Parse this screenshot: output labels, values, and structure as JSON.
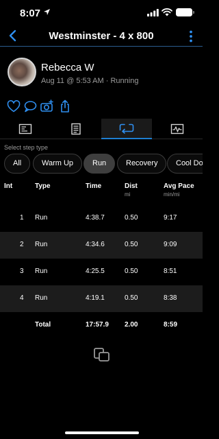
{
  "status_bar": {
    "time": "8:07"
  },
  "nav": {
    "title": "Westminster - 4 x 800"
  },
  "profile": {
    "name": "Rebecca W",
    "meta": "Aug 11 @ 5:53 AM · Running"
  },
  "step_type": {
    "label": "Select step type",
    "chips": [
      "All",
      "Warm Up",
      "Run",
      "Recovery",
      "Cool Down"
    ],
    "selected": "Run"
  },
  "table": {
    "headers": {
      "int": "Int",
      "type": "Type",
      "time": "Time",
      "dist": "Dist",
      "dist_unit": "mi",
      "pace": "Avg Pace",
      "pace_unit": "min/mi"
    },
    "rows": [
      {
        "int": "1",
        "type": "Run",
        "time": "4:38.7",
        "dist": "0.50",
        "pace": "9:17"
      },
      {
        "int": "2",
        "type": "Run",
        "time": "4:34.6",
        "dist": "0.50",
        "pace": "9:09"
      },
      {
        "int": "3",
        "type": "Run",
        "time": "4:25.5",
        "dist": "0.50",
        "pace": "8:51"
      },
      {
        "int": "4",
        "type": "Run",
        "time": "4:19.1",
        "dist": "0.50",
        "pace": "8:38"
      }
    ],
    "total": {
      "label": "Total",
      "time": "17:57.9",
      "dist": "2.00",
      "pace": "8:59"
    }
  },
  "colors": {
    "accent": "#1e7fd1",
    "background": "#000000",
    "row_shade": "#1c1c1c",
    "muted_text": "#9b9b9b"
  },
  "icons": {
    "actions": [
      "heart-icon",
      "comment-icon",
      "camera-plus-icon",
      "share-icon"
    ],
    "tabs": [
      "summary-tab-icon",
      "details-tab-icon",
      "laps-tab-icon",
      "chart-tab-icon"
    ]
  }
}
